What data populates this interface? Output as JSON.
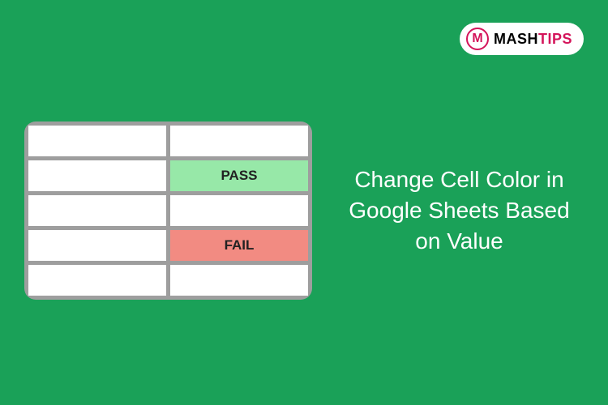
{
  "logo": {
    "icon_letter": "M",
    "text_part1": "MASH",
    "text_part2": "TIPS"
  },
  "table": {
    "rows": [
      {
        "col1": "",
        "col2": "",
        "col2_status": ""
      },
      {
        "col1": "",
        "col2": "PASS",
        "col2_status": "pass"
      },
      {
        "col1": "",
        "col2": "",
        "col2_status": ""
      },
      {
        "col1": "",
        "col2": "FAIL",
        "col2_status": "fail"
      },
      {
        "col1": "",
        "col2": "",
        "col2_status": ""
      }
    ]
  },
  "title": "Change Cell Color in Google Sheets Based on Value",
  "colors": {
    "background": "#1aa158",
    "pass_cell": "#97e8a8",
    "fail_cell": "#f28b82",
    "logo_accent": "#d4145a"
  }
}
